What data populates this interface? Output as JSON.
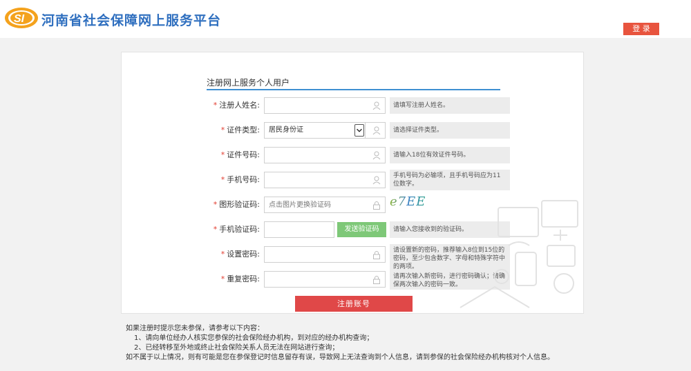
{
  "header": {
    "site_title": "河南省社会保障网上服务平台",
    "logo_text": "SI",
    "login_label": "登 录"
  },
  "form": {
    "title": "注册网上服务个人用户",
    "rows": [
      {
        "label": "注册人姓名:",
        "value": "",
        "hint": "请填写注册人姓名。"
      },
      {
        "label": "证件类型:",
        "value": "居民身份证",
        "hint": "请选择证件类型。"
      },
      {
        "label": "证件号码:",
        "value": "",
        "hint": "请输入18位有效证件号码。"
      },
      {
        "label": "手机号码:",
        "value": "",
        "hint": "手机号码为必输项，且手机号码应为11位数字。"
      },
      {
        "label": "图形验证码:",
        "value": "",
        "placeholder": "点击图片更换验证码",
        "captcha": "e7EE"
      },
      {
        "label": "手机验证码:",
        "value": "",
        "button": "发送验证码",
        "hint": "请输入您接收到的验证码。"
      },
      {
        "label": "设置密码:",
        "value": "",
        "hint": "请设置新的密码，推荐输入8位到15位的密码，至少包含数字、字母和特殊字符中的两项。"
      },
      {
        "label": "重复密码:",
        "value": "",
        "hint": "请再次输入新密码，进行密码确认；请确保两次输入的密码一致。"
      }
    ],
    "submit_label": "注册账号"
  },
  "notes": {
    "intro": "如果注册时提示您未参保，请参考以下内容：",
    "item1": "1、请向单位经办人核实您参保的社会保险经办机构，到对应的经办机构查询；",
    "item2": "2、已经转移至外地或终止社会保险关系人员无法在网站进行查询；",
    "outro": "如不属于以上情况，则有可能是您在参保登记时信息留存有误，导致网上无法查询到个人信息，请到参保的社会保险经办机构核对个人信息。"
  },
  "colors": {
    "brand_blue": "#2f6fbf",
    "login_red": "#e8543e",
    "submit_red": "#e04848",
    "sms_green": "#7ec878",
    "required_star": "#e23a2e"
  },
  "icons": [
    "user-icon",
    "lock-icon",
    "logo-icon",
    "chevron-down-icon"
  ]
}
